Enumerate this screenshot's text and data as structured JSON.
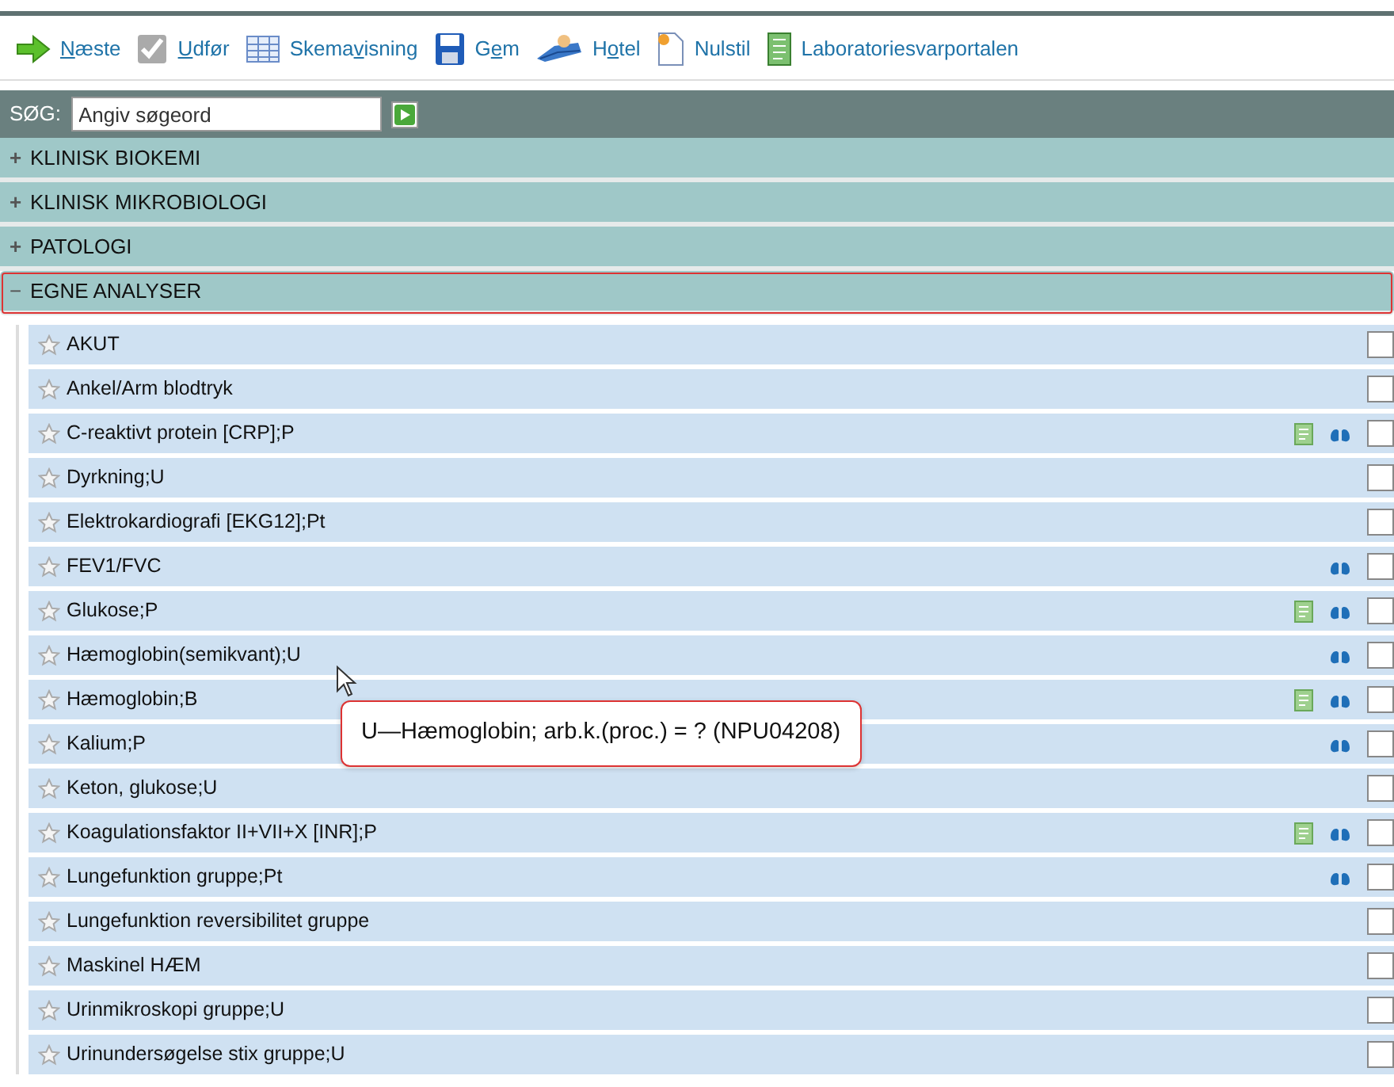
{
  "toolbar": [
    {
      "key": "N",
      "after": "æste"
    },
    {
      "key": "U",
      "after": "dfør"
    },
    {
      "before": "Skema",
      "key": "v",
      "after": "isning"
    },
    {
      "before": "G",
      "key": "e",
      "after": "m"
    },
    {
      "before": "H",
      "key": "o",
      "after": "tel"
    },
    {
      "before": "Nulstil"
    },
    {
      "before": "Laboratoriesvarportalen"
    }
  ],
  "search": {
    "label": "SØG:",
    "placeholder": "Angiv søgeord"
  },
  "categories": [
    {
      "label": "KLINISK BIOKEMI",
      "expanded_sign": "+",
      "expanded": false,
      "focused": false
    },
    {
      "label": "KLINISK MIKROBIOLOGI",
      "expanded_sign": "+",
      "expanded": false,
      "focused": false
    },
    {
      "label": "PATOLOGI",
      "expanded_sign": "+",
      "expanded": false,
      "focused": false
    },
    {
      "label": "EGNE ANALYSER",
      "expanded_sign": "−",
      "expanded": true,
      "focused": true
    }
  ],
  "analyses": [
    {
      "name": "AKUT",
      "report": false,
      "info": false,
      "checked": false
    },
    {
      "name": "Ankel/Arm blodtryk",
      "report": false,
      "info": false,
      "checked": false
    },
    {
      "name": "C-reaktivt protein [CRP];P",
      "report": true,
      "info": true,
      "checked": false
    },
    {
      "name": "Dyrkning;U",
      "report": false,
      "info": false,
      "checked": false
    },
    {
      "name": "Elektrokardiografi [EKG12];Pt",
      "report": false,
      "info": false,
      "checked": false
    },
    {
      "name": "FEV1/FVC",
      "report": false,
      "info": true,
      "checked": false
    },
    {
      "name": "Glukose;P",
      "report": true,
      "info": true,
      "checked": false
    },
    {
      "name": "Hæmoglobin(semikvant);U",
      "report": false,
      "info": true,
      "checked": false
    },
    {
      "name": "Hæmoglobin;B",
      "report": true,
      "info": true,
      "checked": false
    },
    {
      "name": "Kalium;P",
      "report": false,
      "info": true,
      "checked": false
    },
    {
      "name": "Keton, glukose;U",
      "report": false,
      "info": false,
      "checked": false
    },
    {
      "name": "Koagulationsfaktor II+VII+X [INR];P",
      "report": true,
      "info": true,
      "checked": false
    },
    {
      "name": "Lungefunktion gruppe;Pt",
      "report": false,
      "info": true,
      "checked": false
    },
    {
      "name": "Lungefunktion reversibilitet gruppe",
      "report": false,
      "info": false,
      "checked": false
    },
    {
      "name": "Maskinel HÆM",
      "report": false,
      "info": false,
      "checked": false
    },
    {
      "name": "Urinmikroskopi gruppe;U",
      "report": false,
      "info": false,
      "checked": false
    },
    {
      "name": "Urinundersøgelse stix gruppe;U",
      "report": false,
      "info": false,
      "checked": false
    }
  ],
  "tooltip": {
    "text": "U—Hæmoglobin; arb.k.(proc.) = ? (NPU04208)"
  }
}
